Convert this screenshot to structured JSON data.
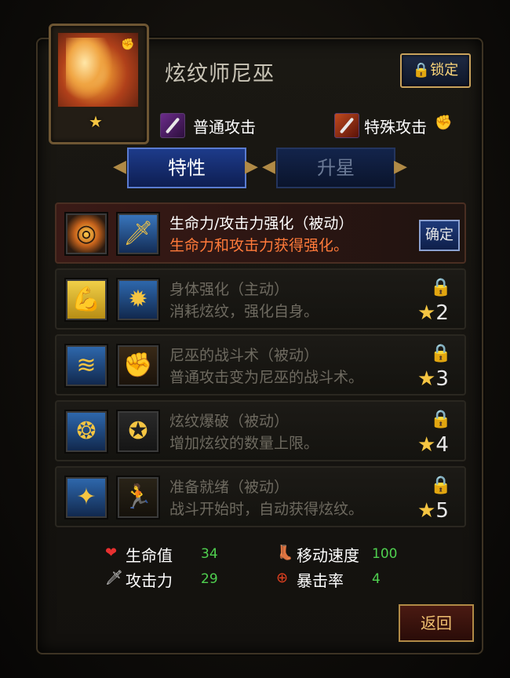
{
  "hero": {
    "name": "炫纹师尼巫",
    "star_icon": "star-icon",
    "lock_label": "🔒锁定"
  },
  "attacks": {
    "normal": {
      "label": "普通攻击",
      "icon": "sword-icon"
    },
    "special": {
      "label": "特殊攻击",
      "icon": "flame-sword-icon"
    }
  },
  "tabs": {
    "traits": "特性",
    "upgrade": "升星"
  },
  "skills": [
    {
      "title": "生命力/攻击力强化（被动）",
      "desc": "生命力和攻击力获得强化。",
      "state": "active",
      "button": "确定"
    },
    {
      "title": "身体强化（主动）",
      "desc": "消耗炫纹，强化自身。",
      "state": "locked",
      "stars": "2"
    },
    {
      "title": "尼巫的战斗术（被动）",
      "desc": "普通攻击变为尼巫的战斗术。",
      "state": "locked",
      "stars": "3"
    },
    {
      "title": "炫纹爆破（被动）",
      "desc": "增加炫纹的数量上限。",
      "state": "locked",
      "stars": "4"
    },
    {
      "title": "准备就绪（被动）",
      "desc": "战斗开始时，自动获得炫纹。",
      "state": "locked",
      "stars": "5"
    }
  ],
  "stats": {
    "hp": {
      "label": "生命值",
      "value": "34"
    },
    "atk": {
      "label": "攻击力",
      "value": "29"
    },
    "move": {
      "label": "移动速度",
      "value": "100"
    },
    "crit": {
      "label": "暴击率",
      "value": "4"
    }
  },
  "return_label": "返回",
  "colors": {
    "gold": "#f5c542",
    "active_desc": "#ff7a3a",
    "stat_value": "#4fd04f"
  }
}
